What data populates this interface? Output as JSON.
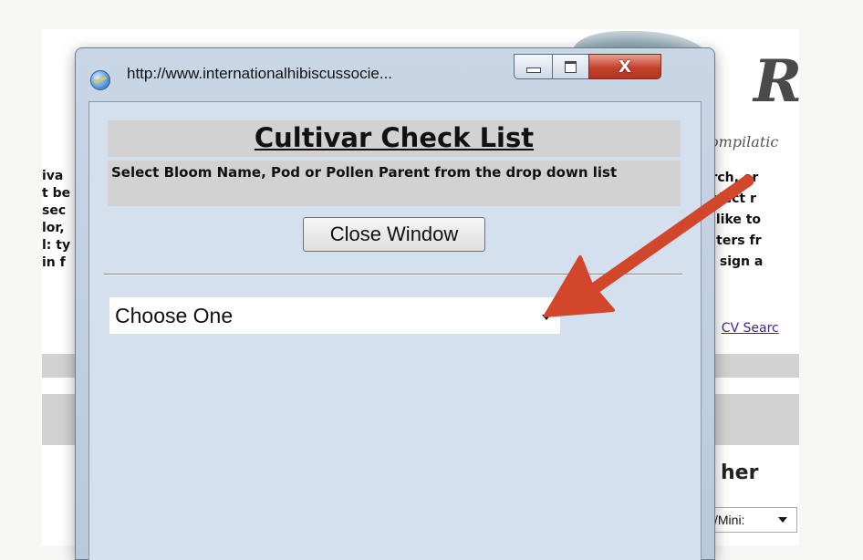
{
  "background_page": {
    "subtitle_fragment": "ompilatic",
    "left_text_lines": [
      "iva",
      "t be",
      "sec",
      "lor,",
      "l: ty",
      "in f"
    ],
    "right_text_lines": [
      "arch, or",
      "select r",
      "u like to",
      "filters fr",
      "% sign a"
    ],
    "links": {
      "separator": "|",
      "cv_search": "CV Searc"
    },
    "section_heading_fragment": "her",
    "mini_select_value": "/Mini:",
    "logo_letter": "R"
  },
  "window": {
    "title": "http://www.internationalhibiscussocie...",
    "icon": "internet-explorer-icon",
    "caption_buttons": {
      "minimize_icon": "minimize-icon",
      "maximize_icon": "maximize-icon",
      "close_glyph": "X"
    },
    "accent_close_color": "#c4412b"
  },
  "dialog": {
    "heading": "Cultivar Check List",
    "instruction": "Select Bloom Name, Pod or Pollen Parent from the drop down list",
    "close_button_label": "Close Window",
    "select": {
      "selected_value": "Choose One"
    }
  },
  "annotation": {
    "arrow_color": "#d2462c"
  }
}
